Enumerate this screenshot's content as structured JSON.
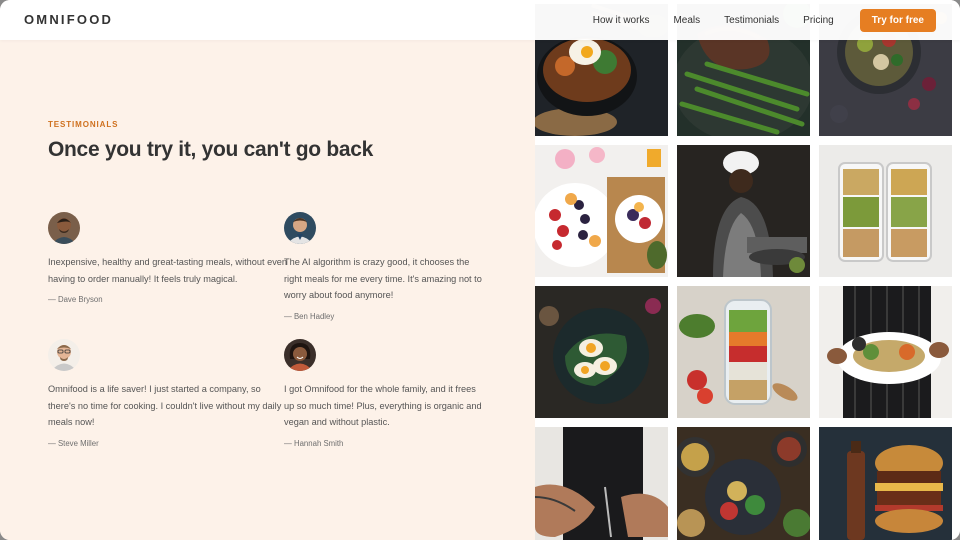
{
  "header": {
    "logo": "OMNIFOOD",
    "nav": [
      {
        "label": "How it works"
      },
      {
        "label": "Meals"
      },
      {
        "label": "Testimonials"
      },
      {
        "label": "Pricing"
      }
    ],
    "cta_label": "Try for free"
  },
  "section": {
    "subheading": "TESTIMONIALS",
    "heading": "Once you try it, you can't go back"
  },
  "testimonials": [
    {
      "quote": "Inexpensive, healthy and great-tasting meals, without even having to order manually! It feels truly magical.",
      "name": "— Dave Bryson"
    },
    {
      "quote": "The AI algorithm is crazy good, it chooses the right meals for me every time. It's amazing not to worry about food anymore!",
      "name": "— Ben Hadley"
    },
    {
      "quote": "Omnifood is a life saver! I just started a company, so there's no time for cooking. I couldn't live without my daily meals now!",
      "name": "— Steve Miller"
    },
    {
      "quote": "I got Omnifood for the whole family, and it frees up so much time! Plus, everything is organic and vegan and without plastic.",
      "name": "— Hannah Smith"
    }
  ],
  "colors": {
    "accent": "#e67e22",
    "accent_dark": "#cf711f",
    "background": "#fdf2e9",
    "text": "#333333"
  },
  "gallery": {
    "images": [
      "bibimbap-bowl-image",
      "steak-asparagus-image",
      "salad-bowl-image",
      "fruit-platter-image",
      "chef-cooking-image",
      "meal-prep-containers-image",
      "egg-salad-plate-image",
      "salad-jar-image",
      "plate-held-image",
      "chef-plating-image",
      "bowls-table-image",
      "burger-image"
    ]
  }
}
